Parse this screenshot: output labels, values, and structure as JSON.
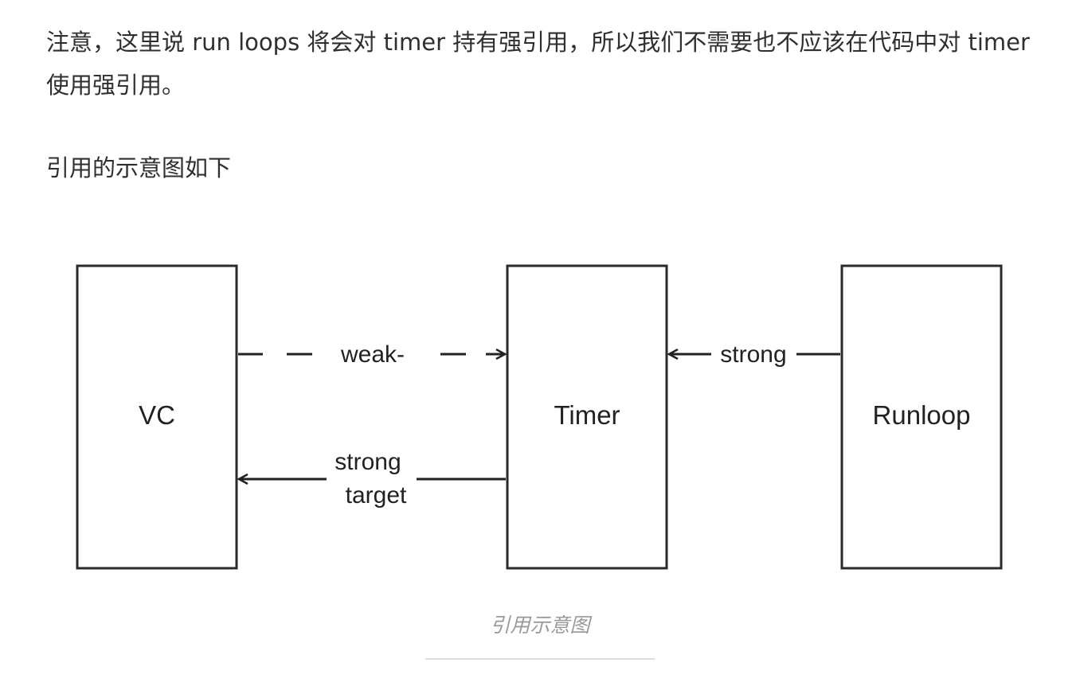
{
  "article": {
    "paragraph1": "注意，这里说 run loops 将会对 timer 持有强引用，所以我们不需要也不应该在代码中对 timer 使用强引用。",
    "paragraph2": "引用的示意图如下"
  },
  "figure": {
    "boxes": {
      "vc": "VC",
      "timer": "Timer",
      "runloop": "Runloop"
    },
    "edges": {
      "vc_to_timer": "weak-",
      "runloop_to_timer": "strong",
      "timer_to_vc_line1": "strong",
      "timer_to_vc_line2": "target"
    },
    "caption": "引用示意图"
  }
}
